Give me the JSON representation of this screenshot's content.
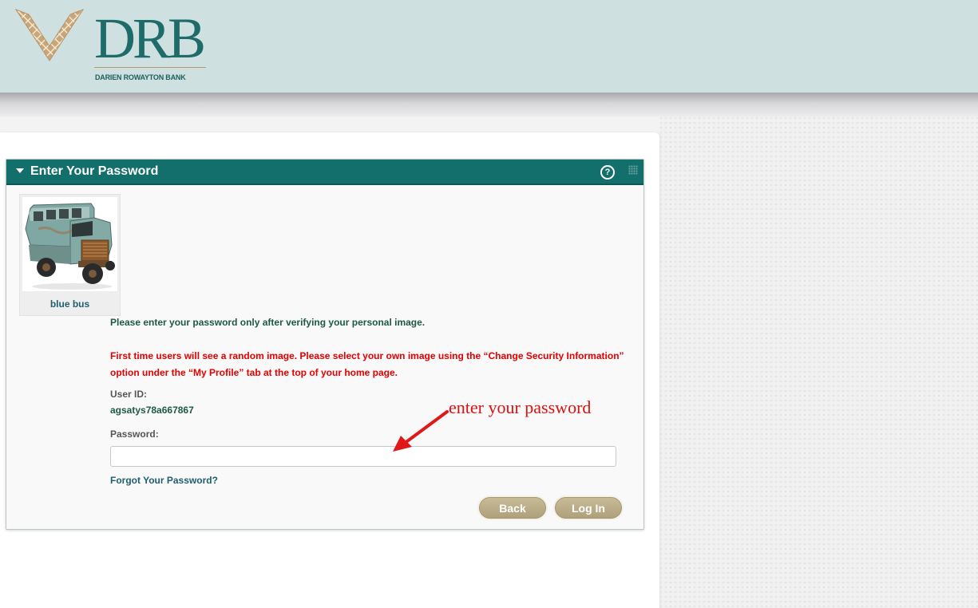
{
  "brand": {
    "logo_text": "DRB",
    "bank_name": "DARIEN ROWAYTON BANK"
  },
  "panel": {
    "title": "Enter Your Password",
    "help_symbol": "?",
    "security_image": {
      "caption": "blue bus",
      "icon": "bus-image"
    },
    "verify_message": "Please enter your password only after verifying your personal image.",
    "first_time_message": "First time users will see a random image. Please select your own image using the “Change Security Information” option under the “My Profile” tab at the top of your home page.",
    "user_id_label": "User ID:",
    "user_id_value": "agsatys78a667867",
    "password_label": "Password:",
    "password_value": "",
    "forgot_link": "Forgot Your Password?",
    "back_button": "Back",
    "login_button": "Log In"
  },
  "annotation": {
    "text": "enter your password",
    "color": "#dd1111"
  },
  "colors": {
    "header_bg": "#cfe0e0",
    "panel_header": "#126f6b",
    "button_tan": "#b8ab86",
    "error_red": "#e60000"
  }
}
